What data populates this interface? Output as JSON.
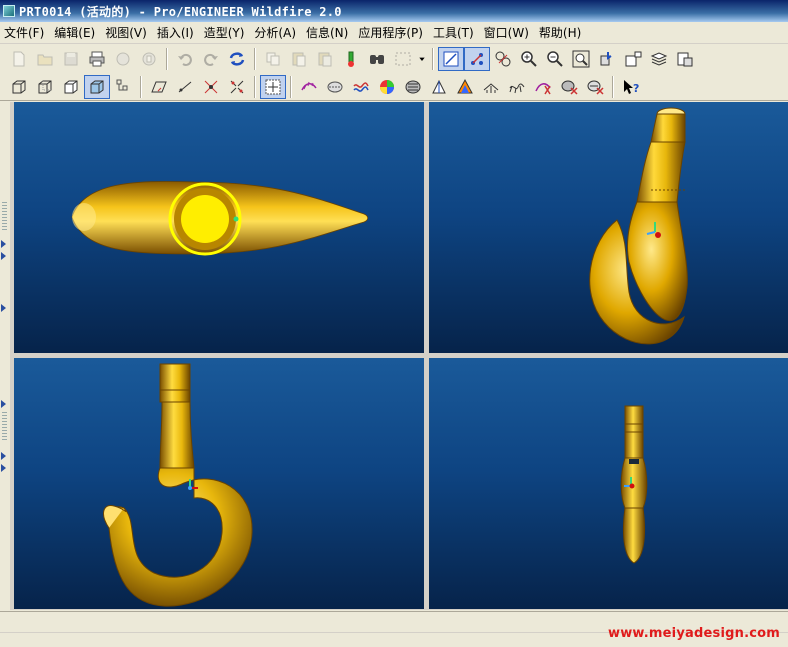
{
  "window": {
    "title": "PRT0014 (活动的) - Pro/ENGINEER Wildfire 2.0"
  },
  "menu": [
    {
      "label": "文件(F)"
    },
    {
      "label": "编辑(E)"
    },
    {
      "label": "视图(V)"
    },
    {
      "label": "插入(I)"
    },
    {
      "label": "造型(Y)"
    },
    {
      "label": "分析(A)"
    },
    {
      "label": "信息(N)"
    },
    {
      "label": "应用程序(P)"
    },
    {
      "label": "工具(T)"
    },
    {
      "label": "窗口(W)"
    },
    {
      "label": "帮助(H)"
    }
  ],
  "toolbar1": {
    "icons": [
      "new-file-icon",
      "open-file-icon",
      "save-icon",
      "print-icon",
      "send-mail-icon",
      "send-mail-attach-icon",
      "undo-icon",
      "redo-icon",
      "regenerate-icon",
      "copy-icon",
      "paste-icon",
      "paste-special-icon",
      "model-tree-icon",
      "find-icon",
      "selection-filter-icon",
      "dropdown-icon",
      "datum-plane-toggle-icon",
      "datum-axis-toggle-icon",
      "datum-point-toggle-icon",
      "zoom-in-icon",
      "zoom-out-icon",
      "refit-icon",
      "orient-icon",
      "saved-views-icon",
      "layers-icon",
      "view-manager-icon"
    ]
  },
  "toolbar2": {
    "icons": [
      "wireframe-icon",
      "hidden-line-icon",
      "no-hidden-icon",
      "shading-icon",
      "model-tree-toggle-icon",
      "spin-center-icon",
      "datum-planes-icon",
      "datum-axes-icon",
      "datum-points-icon",
      "csys-icon",
      "curvature-analysis-icon",
      "section-analysis-icon",
      "offset-analysis-icon",
      "draft-analysis-icon",
      "reflection-analysis-icon",
      "slope-analysis-icon",
      "shaded-curvature-icon",
      "dihedral-icon",
      "deviation-icon",
      "curve-analysis-icon",
      "delete-analysis-icon",
      "delete-all-analysis-icon",
      "whats-this-help-icon"
    ]
  },
  "viewports": [
    {
      "name": "top-view"
    },
    {
      "name": "isometric-view"
    },
    {
      "name": "front-view"
    },
    {
      "name": "side-view"
    }
  ],
  "colors": {
    "model_gold": "#e8b70c",
    "model_shadow": "#8a5a00",
    "model_highlight": "#ffe98a",
    "viewport_top": "#1a5a9a",
    "viewport_bottom": "#06234a",
    "selection_yellow": "#ffff00",
    "watermark_red": "#e01b1b"
  },
  "watermark": "www.meiyadesign.com"
}
